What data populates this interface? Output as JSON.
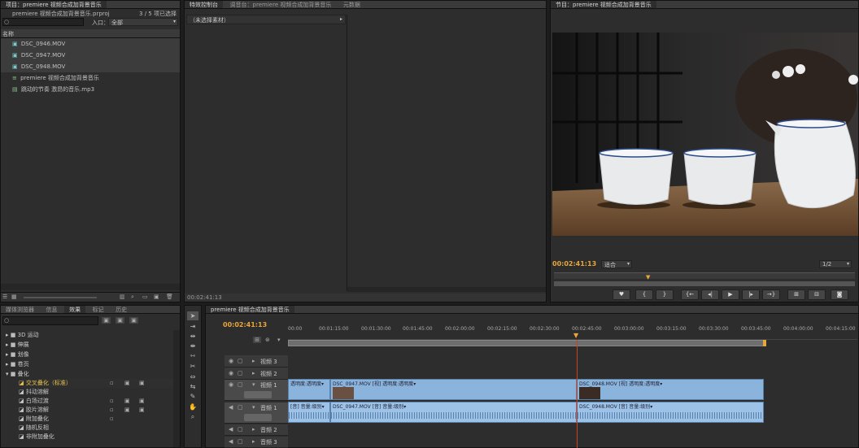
{
  "project": {
    "tab": "项目：premiere 视频合成加背景音乐",
    "file": "premiere 视频合成加背景音乐.prproj",
    "count": "3 / 5 项已选择",
    "entry_label": "入口：",
    "entry_value": "全部",
    "col_name": "名称",
    "items": [
      {
        "name": "DSC_0946.MOV",
        "icon": "video-file-icon"
      },
      {
        "name": "DSC_0947.MOV",
        "icon": "video-file-icon"
      },
      {
        "name": "DSC_0948.MOV",
        "icon": "video-file-icon"
      },
      {
        "name": "premiere 视频合成加背景音乐",
        "icon": "sequence-icon"
      },
      {
        "name": "跳动的节奏 激昂的音乐.mp3",
        "icon": "audio-file-icon"
      }
    ]
  },
  "effect_controls": {
    "tabs": [
      "特效控制台",
      "调音台：premiere 视频合成加背景音乐",
      "元数据"
    ],
    "no_clip": "（未选择素材）",
    "timecode": "00:02:41:13"
  },
  "program": {
    "tab": "节目：premiere 视频合成加背景音乐",
    "timecode": "00:02:41:13",
    "fit": "适合",
    "quality": "1/2"
  },
  "effects": {
    "tabs": [
      "媒体浏览器",
      "信息",
      "效果",
      "标记",
      "历史"
    ],
    "folders": [
      "3D 运动",
      "伸展",
      "划像",
      "卷页",
      "叠化"
    ],
    "items": [
      "交叉叠化（标准）",
      "抖动溶解",
      "白场过渡",
      "胶片溶解",
      "附加叠化",
      "随机反相",
      "非附加叠化"
    ]
  },
  "timeline": {
    "tab": "premiere 视频合成加背景音乐",
    "timecode": "00:02:41:13",
    "ruler": [
      "00:00",
      "00:01:15:00",
      "00:01:30:00",
      "00:01:45:00",
      "00:02:00:00",
      "00:02:15:00",
      "00:02:30:00",
      "00:02:45:00",
      "00:03:00:00",
      "00:03:15:00",
      "00:03:30:00",
      "00:03:45:00",
      "00:04:00:00",
      "00:04:15:00"
    ],
    "tracks": {
      "v3": "视频 3",
      "v2": "视频 2",
      "v1": "视频 1",
      "a1": "音频 1",
      "a2": "音频 2",
      "a3": "音频 3"
    },
    "video_clips": {
      "c1": "透明度:透明度▾",
      "c2": "DSC_0947.MOV [视] 透明度:透明度▾",
      "c3": "DSC_0948.MOV [视] 透明度:透明度▾"
    },
    "audio_clips": {
      "c1": "[音] 音量:级别▾",
      "c2": "DSC_0947.MOV [音] 音量:级别▾",
      "c3": "DSC_0948.MOV [音] 音量:级别▾"
    }
  }
}
